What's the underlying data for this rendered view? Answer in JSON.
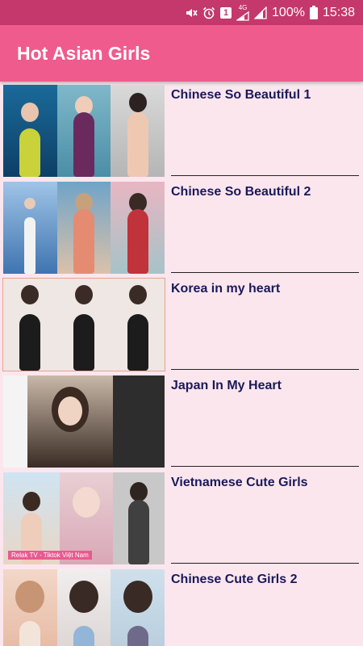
{
  "status_bar": {
    "network": "4G",
    "sim_badge": "1",
    "battery": "100%",
    "time": "15:38",
    "icons": [
      "mute-icon",
      "alarm-icon",
      "sim-icon",
      "signal-icon",
      "signal-icon",
      "battery-icon"
    ]
  },
  "app_bar": {
    "title": "Hot Asian Girls"
  },
  "colors": {
    "status_bar": "#c4386b",
    "app_bar": "#ef5b8c",
    "background": "#fce6ee",
    "title_text": "#1a1a5a"
  },
  "items": [
    {
      "title": "Chinese So Beautiful 1"
    },
    {
      "title": "Chinese So Beautiful 2"
    },
    {
      "title": "Korea in my heart"
    },
    {
      "title": "Japan In My Heart"
    },
    {
      "title": "Vietnamese Cute Girls",
      "thumb_caption": "Relak TV - Tiktok Việt Nam"
    },
    {
      "title": "Chinese Cute Girls 2"
    }
  ]
}
